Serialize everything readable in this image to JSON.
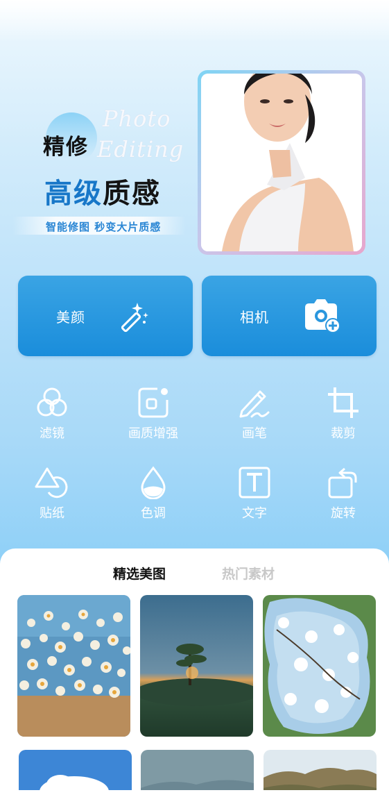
{
  "hero": {
    "title_line1": "精修",
    "script_line1": "Photo",
    "script_line2": "Editing",
    "title_line2_part1": "高级",
    "title_line2_part2": "质感",
    "subtitle": "智能修图 秒变大片质感"
  },
  "primary_actions": [
    {
      "label": "美颜",
      "icon": "magic-wand-icon"
    },
    {
      "label": "相机",
      "icon": "camera-add-icon"
    }
  ],
  "tools": [
    {
      "label": "滤镜",
      "icon": "filter-circles-icon"
    },
    {
      "label": "画质增强",
      "icon": "enhance-icon"
    },
    {
      "label": "画笔",
      "icon": "pen-icon"
    },
    {
      "label": "裁剪",
      "icon": "crop-icon"
    },
    {
      "label": "贴纸",
      "icon": "sticker-shapes-icon"
    },
    {
      "label": "色调",
      "icon": "droplet-icon"
    },
    {
      "label": "文字",
      "icon": "text-icon"
    },
    {
      "label": "旋转",
      "icon": "rotate-icon"
    }
  ],
  "tabs": [
    {
      "label": "精选美图",
      "active": true
    },
    {
      "label": "热门素材",
      "active": false
    }
  ],
  "colors": {
    "accent": "#1a8ddb",
    "title_blue": "#1877c8",
    "tab_inactive": "#c8c8c8"
  }
}
